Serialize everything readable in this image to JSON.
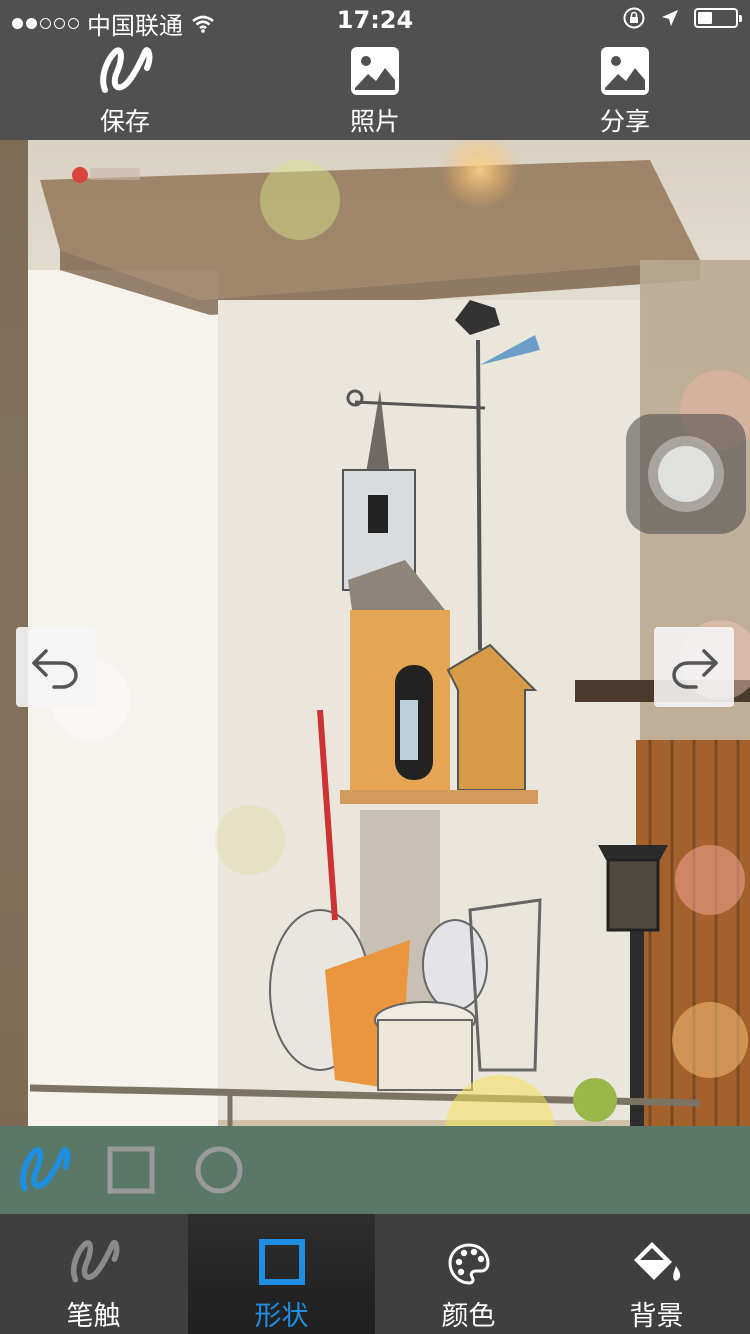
{
  "status_bar": {
    "carrier": "中国联通",
    "signal_strength": 2,
    "signal_total": 5,
    "time": "17:24",
    "battery_level": 0.4
  },
  "toolbar": {
    "save_label": "保存",
    "photo_label": "照片",
    "share_label": "分享"
  },
  "canvas": {
    "undo_icon": "undo-icon",
    "redo_icon": "redo-icon"
  },
  "shape_options": [
    "freehand",
    "rectangle",
    "circle"
  ],
  "selected_shape": "freehand",
  "tabs": [
    {
      "label": "笔触",
      "icon": "brush-icon"
    },
    {
      "label": "形状",
      "icon": "square-icon"
    },
    {
      "label": "颜色",
      "icon": "palette-icon"
    },
    {
      "label": "背景",
      "icon": "paint-bucket-icon"
    }
  ],
  "active_tab": "形状",
  "colors": {
    "accent": "#1e8fe0",
    "toolbar_bg": "#505050",
    "shape_bar_bg": "#5a7868",
    "tab_bar_bg": "#3f3f3f"
  }
}
